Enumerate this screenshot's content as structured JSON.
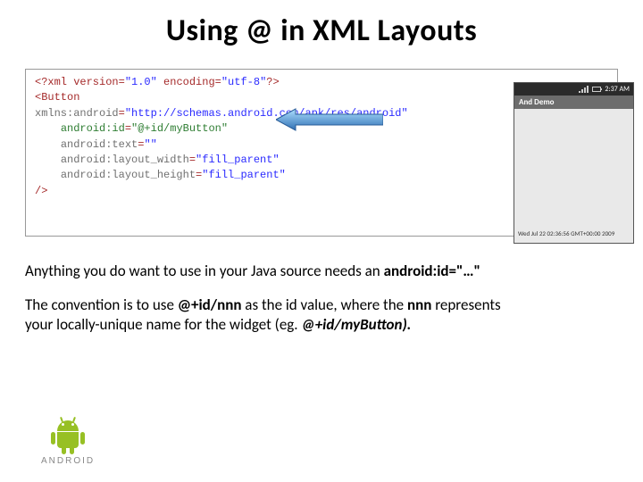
{
  "title": "Using @ in XML Layouts",
  "code": {
    "l1_a": "<?xml version=",
    "l1_b": "\"1.0\"",
    "l1_c": " encoding=",
    "l1_d": "\"utf-8\"",
    "l1_e": "?>",
    "l2": "<Button",
    "l3_a": "xmlns:android",
    "l3_eq": "=",
    "l3_v": "\"http://schemas.android.com/apk/res/android\"",
    "l4_a": "android:id",
    "l4_eq": "=",
    "l4_v": "\"@+id/myButton\"",
    "l5_a": "android:text",
    "l5_eq": "=",
    "l5_v": "\"\"",
    "l6_a": "android:layout_width",
    "l6_eq": "=",
    "l6_v": "\"fill_parent\"",
    "l7_a": "android:layout_height",
    "l7_eq": "=",
    "l7_v": "\"fill_parent\"",
    "l8": "/>"
  },
  "phone": {
    "time": "2:37 AM",
    "app_title": "And Demo",
    "date_line": "Wed Jul 22 02:36:56 GMT+00:00 2009"
  },
  "para1_pre": "Anything you do want to use in your Java source needs an ",
  "para1_bold": "android:id=\"…\"",
  "para2_a": "The convention is to use ",
  "para2_b": "@+id/nnn",
  "para2_c": " as the id value, where the ",
  "para2_d": "nnn",
  "para2_e": " represents your locally-unique name for the widget (eg. ",
  "para2_f": "@+id/myButton",
  "para2_g": ").",
  "wordmark": "android"
}
